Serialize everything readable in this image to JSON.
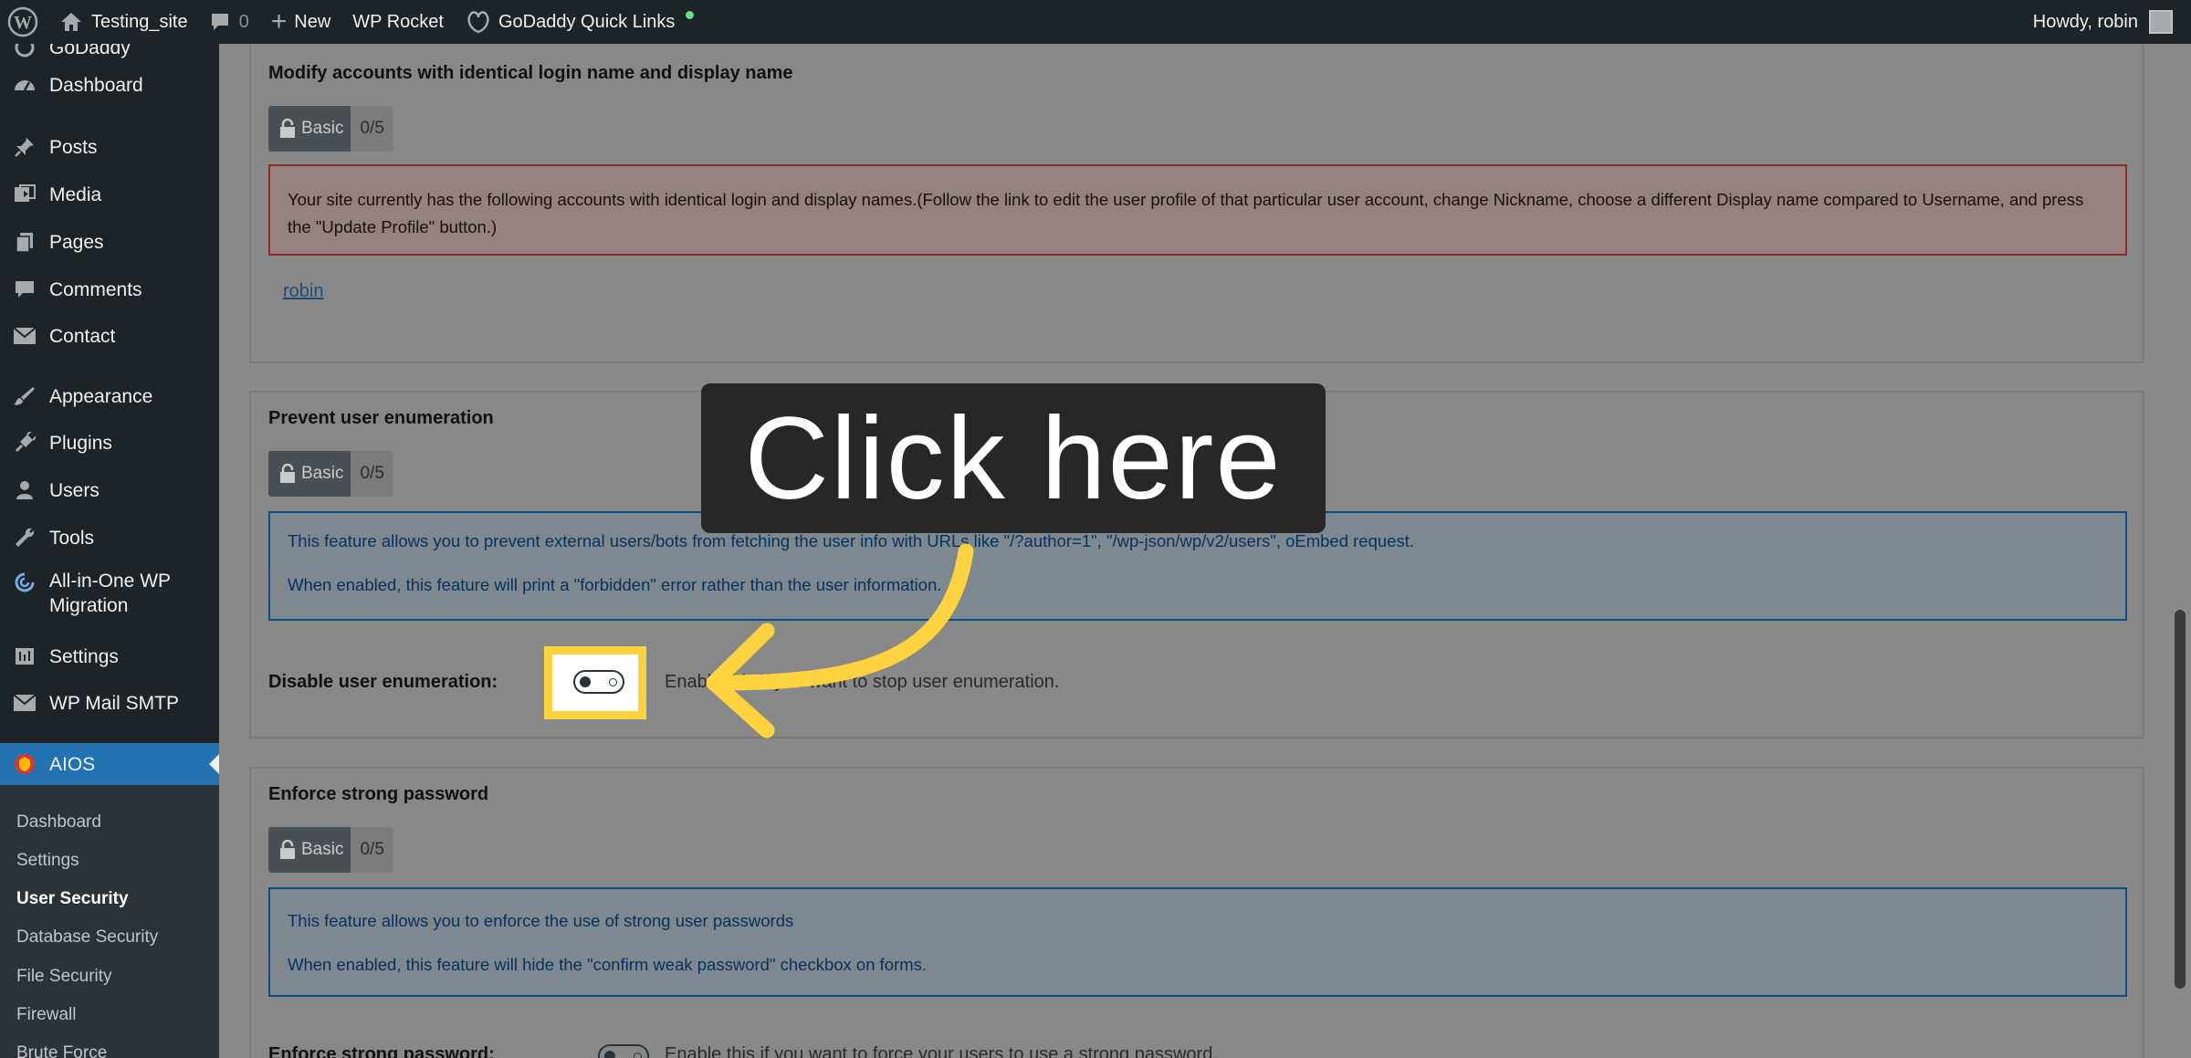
{
  "adminbar": {
    "site_name": "Testing_site",
    "comments_count": "0",
    "new_label": "New",
    "wp_rocket_label": "WP Rocket",
    "godaddy_label": "GoDaddy Quick Links",
    "howdy": "Howdy, robin"
  },
  "sidebar": {
    "cutoff_label": "GoDaddy",
    "items": [
      {
        "label": "Dashboard",
        "icon": "dashboard-icon"
      },
      {
        "label": "Posts",
        "icon": "pin-icon"
      },
      {
        "label": "Media",
        "icon": "media-icon"
      },
      {
        "label": "Pages",
        "icon": "pages-icon"
      },
      {
        "label": "Comments",
        "icon": "comment-icon"
      },
      {
        "label": "Contact",
        "icon": "mail-icon"
      },
      {
        "label": "Appearance",
        "icon": "brush-icon"
      },
      {
        "label": "Plugins",
        "icon": "plug-icon"
      },
      {
        "label": "Users",
        "icon": "users-icon"
      },
      {
        "label": "Tools",
        "icon": "wrench-icon"
      },
      {
        "label": "All-in-One WP",
        "label2": "Migration",
        "icon": "migration-icon"
      },
      {
        "label": "Settings",
        "icon": "settings-icon"
      },
      {
        "label": "WP Mail SMTP",
        "icon": "mail-icon"
      },
      {
        "label": "AIOS",
        "icon": "aios-icon"
      }
    ],
    "submenu": [
      "Dashboard",
      "Settings",
      "User Security",
      "Database Security",
      "File Security",
      "Firewall",
      "Brute Force"
    ],
    "submenu_current": "User Security"
  },
  "panels": {
    "identical": {
      "title": "Modify accounts with identical login name and display name",
      "badge_label": "Basic",
      "badge_score": "0/5",
      "notice": "Your site currently has the following accounts with identical login and display names.(Follow the link to edit the user profile of that particular user account, change Nickname, choose a different Display name compared to Username, and press the \"Update Profile\" button.)",
      "user_link": "robin"
    },
    "enumeration": {
      "title": "Prevent user enumeration",
      "badge_label": "Basic",
      "badge_score": "0/5",
      "notice_line1": "This feature allows you to prevent external users/bots from fetching the user info with URLs like \"/?author=1\", \"/wp-json/wp/v2/users\", oEmbed request.",
      "notice_line2": "When enabled, this feature will print a \"forbidden\" error rather than the user information.",
      "row_label": "Disable user enumeration:",
      "row_desc": "Enable this if you want to stop user enumeration."
    },
    "password": {
      "title": "Enforce strong password",
      "badge_label": "Basic",
      "badge_score": "0/5",
      "notice_line1": "This feature allows you to enforce the use of strong user passwords",
      "notice_line2": "When enabled, this feature will hide the \"confirm weak password\" checkbox on forms.",
      "row_label": "Enforce strong password:",
      "row_desc": "Enable this if you want to force your users to use a strong password."
    }
  },
  "callout": {
    "text": "Click here",
    "highlight_color": "#ffd23f",
    "arrow_color": "#ffd23f"
  }
}
